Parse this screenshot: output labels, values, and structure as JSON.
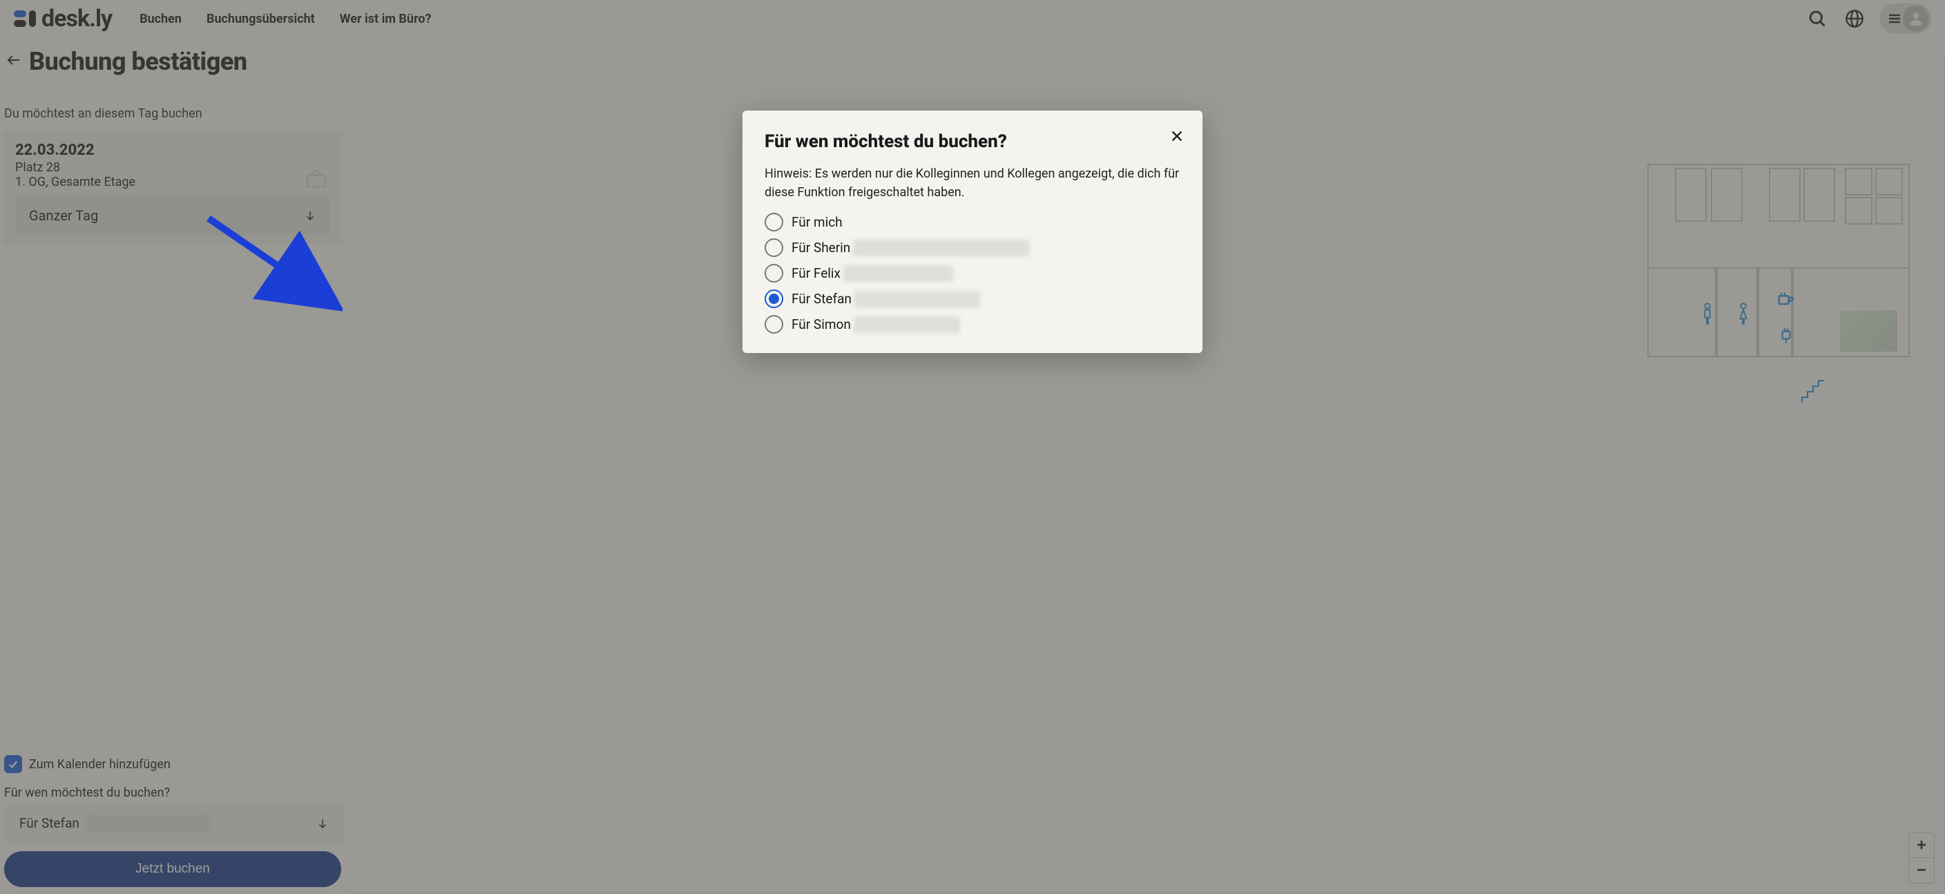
{
  "brand": "desk.ly",
  "nav": {
    "book": "Buchen",
    "overview": "Buchungsübersicht",
    "who": "Wer ist im Büro?"
  },
  "page": {
    "title": "Buchung bestätigen",
    "subtitle": "Du möchtest an diesem Tag buchen",
    "date": "22.03.2022",
    "place": "Platz 28",
    "floor": "1. OG, Gesamte Etage",
    "time_option": "Ganzer Tag",
    "calendar_label": "Zum Kalender hinzufügen",
    "calendar_checked": true,
    "who_label": "Für wen möchtest du buchen?",
    "who_selected": "Für Stefan",
    "who_selected_blur": "■■■■ ■■■■■■■■■■ ■",
    "book_button": "Jetzt buchen"
  },
  "zoom": {
    "in": "+",
    "out": "−"
  },
  "dialog": {
    "title": "Für wen möchtest du buchen?",
    "hint": "Hinweis: Es werden nur die Kolleginnen und Kollegen angezeigt, die dich für diese Funktion freigeschaltet haben.",
    "options": [
      {
        "label": "Für mich",
        "blur": "",
        "selected": false
      },
      {
        "label": "Für Sherin",
        "blur": "■■■■ ■■■■ ■■■■■ ■■■■■■■■",
        "selected": false
      },
      {
        "label": "Für Felix",
        "blur": "■■■ ■■■■■■■■■ ■",
        "selected": false
      },
      {
        "label": "Für Stefan",
        "blur": "■■■■ ■■■■■■■■■■ ■",
        "selected": true
      },
      {
        "label": "Für Simon",
        "blur": "■■■■■■■■■■■■ ■",
        "selected": false
      }
    ]
  },
  "colors": {
    "primary": "#1b5cd6",
    "primary_dark": "#183b8a",
    "bg": "#f5f3ef"
  }
}
